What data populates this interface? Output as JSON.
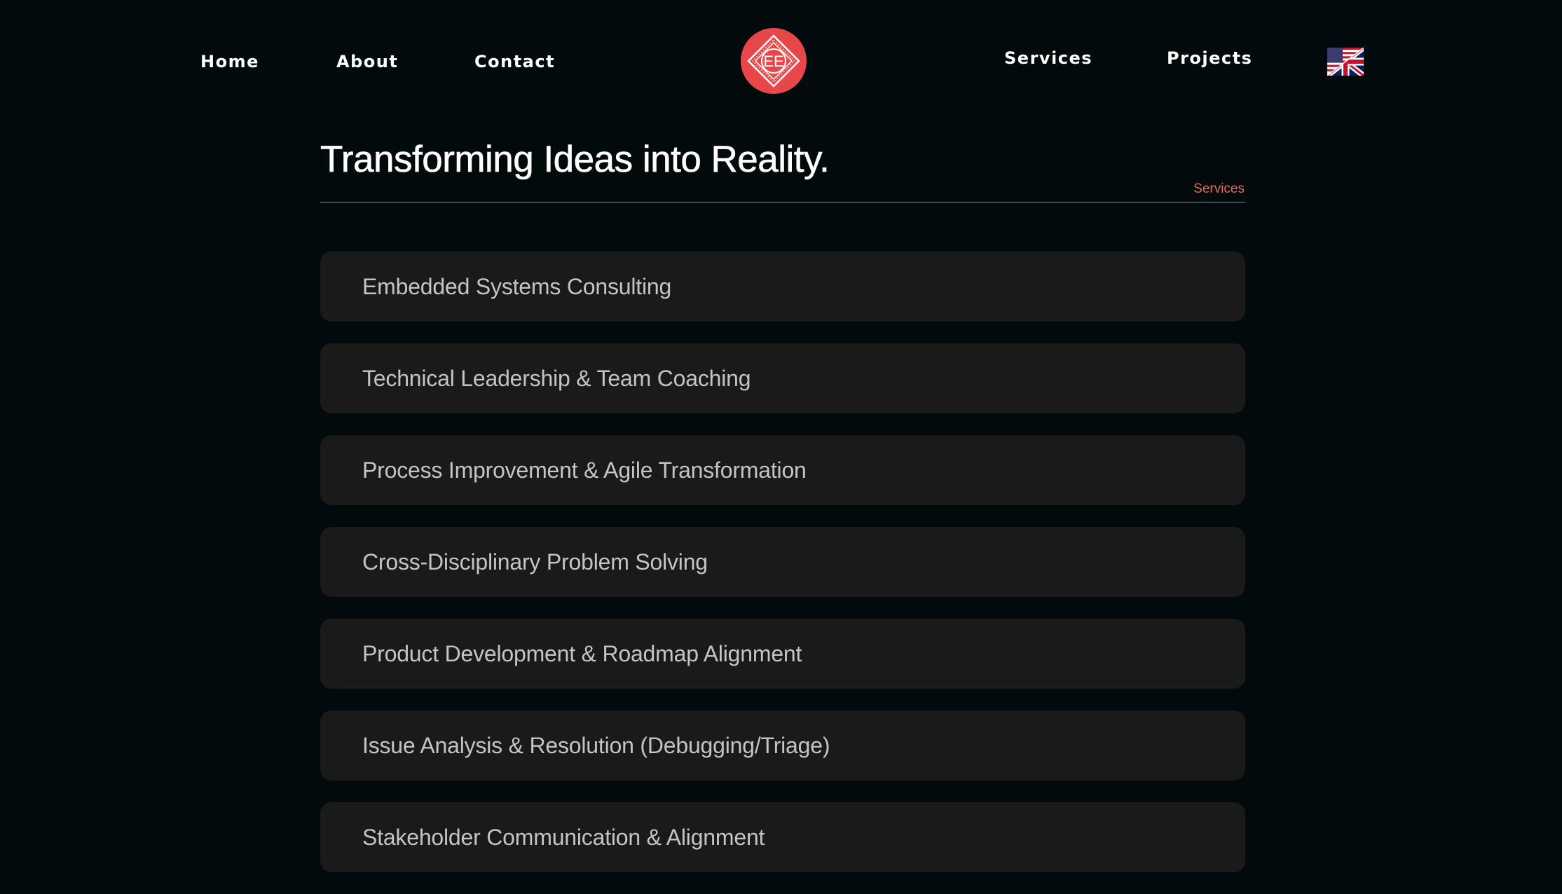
{
  "nav": {
    "home": "Home",
    "about": "About",
    "contact": "Contact",
    "services": "Services",
    "projects": "Projects"
  },
  "logo": {
    "text": "EE",
    "color": "#e8474a"
  },
  "language": {
    "icon": "us-uk-flag-icon"
  },
  "header": {
    "title": "Transforming Ideas into Reality.",
    "section_label": "Services"
  },
  "services": [
    {
      "label": "Embedded Systems Consulting"
    },
    {
      "label": "Technical Leadership & Team Coaching"
    },
    {
      "label": "Process Improvement & Agile Transformation"
    },
    {
      "label": "Cross-Disciplinary Problem Solving"
    },
    {
      "label": "Product Development & Roadmap Alignment"
    },
    {
      "label": "Issue Analysis & Resolution (Debugging/Triage)"
    },
    {
      "label": "Stakeholder Communication & Alignment"
    }
  ],
  "colors": {
    "background": "#020a0c",
    "card": "#1a1a1b",
    "accent": "#e8685c"
  }
}
